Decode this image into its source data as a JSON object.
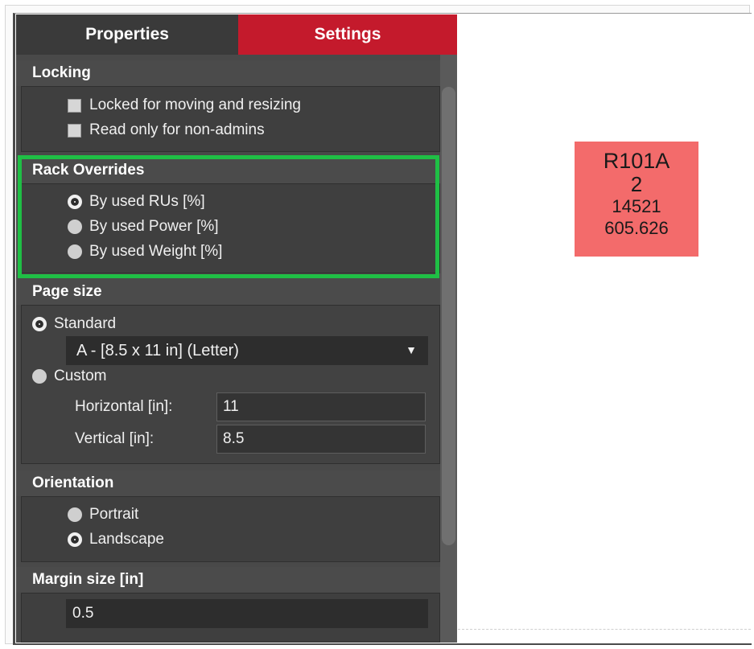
{
  "tabs": {
    "properties": "Properties",
    "settings": "Settings",
    "active": "Settings"
  },
  "locking": {
    "title": "Locking",
    "options": [
      {
        "label": "Locked for moving and resizing",
        "checked": false
      },
      {
        "label": "Read only for non-admins",
        "checked": false
      }
    ]
  },
  "rack_overrides": {
    "title": "Rack Overrides",
    "options": [
      {
        "label": "By used RUs [%]",
        "selected": true
      },
      {
        "label": "By used Power [%]",
        "selected": false
      },
      {
        "label": "By used Weight [%]",
        "selected": false
      }
    ]
  },
  "page_size": {
    "title": "Page size",
    "standard_label": "Standard",
    "standard_selected": true,
    "select_value": "A - [8.5 x 11 in] (Letter)",
    "custom_label": "Custom",
    "horizontal_label": "Horizontal [in]:",
    "horizontal_value": "11",
    "vertical_label": "Vertical [in]:",
    "vertical_value": "8.5"
  },
  "orientation": {
    "title": "Orientation",
    "options": [
      {
        "label": "Portrait",
        "selected": false
      },
      {
        "label": "Landscape",
        "selected": true
      }
    ]
  },
  "margin": {
    "title": "Margin size [in]",
    "value": "0.5"
  },
  "rack": {
    "name": "R101A",
    "line2": "2",
    "line3": "14521",
    "line4": "605.626",
    "color": "#f36b6b"
  },
  "colors": {
    "settings_tab": "#c41a2c",
    "highlight": "#1fbf45"
  }
}
